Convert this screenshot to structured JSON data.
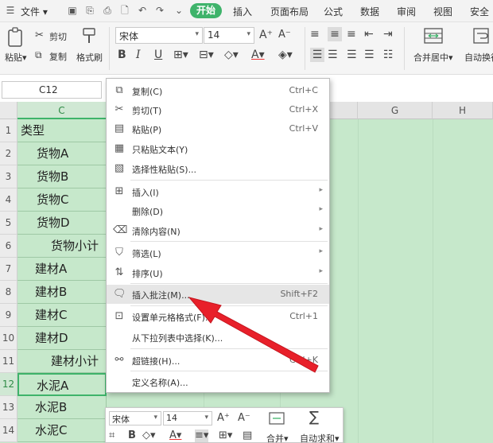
{
  "menubar": {
    "file": "文件",
    "tabs": [
      "开始",
      "插入",
      "页面布局",
      "公式",
      "数据",
      "审阅",
      "视图",
      "安全"
    ]
  },
  "ribbon": {
    "paste": "粘贴",
    "cut": "剪切",
    "copy": "复制",
    "format_painter": "格式刷",
    "font_name": "宋体",
    "font_size": "14",
    "merge_center": "合并居中",
    "wrap_text": "自动换行"
  },
  "name_box": "C12",
  "columns": [
    "C",
    "G",
    "H"
  ],
  "rows": [
    {
      "num": "1",
      "c": "类型"
    },
    {
      "num": "2",
      "c": "货物A"
    },
    {
      "num": "3",
      "c": "货物B"
    },
    {
      "num": "4",
      "c": "货物C"
    },
    {
      "num": "5",
      "c": "货物D"
    },
    {
      "num": "6",
      "c": "货物小计"
    },
    {
      "num": "7",
      "c": "建材A"
    },
    {
      "num": "8",
      "c": "建材B"
    },
    {
      "num": "9",
      "c": "建材C"
    },
    {
      "num": "10",
      "c": "建材D"
    },
    {
      "num": "11",
      "c": "建材小计"
    },
    {
      "num": "12",
      "c": "水泥A"
    },
    {
      "num": "13",
      "c": "水泥B"
    },
    {
      "num": "14",
      "c": "水泥C"
    }
  ],
  "context_menu": {
    "copy": {
      "label": "复制(C)",
      "shortcut": "Ctrl+C",
      "icon": "copy-icon"
    },
    "cut": {
      "label": "剪切(T)",
      "shortcut": "Ctrl+X",
      "icon": "scissors-icon"
    },
    "paste": {
      "label": "粘贴(P)",
      "shortcut": "Ctrl+V",
      "icon": "paste-icon"
    },
    "paste_text": {
      "label": "只粘贴文本(Y)",
      "icon": "paste-text-icon"
    },
    "paste_special": {
      "label": "选择性粘贴(S)...",
      "icon": "paste-special-icon"
    },
    "insert": {
      "label": "插入(I)",
      "icon": "insert-icon"
    },
    "delete": {
      "label": "删除(D)"
    },
    "clear": {
      "label": "清除内容(N)",
      "icon": "eraser-icon"
    },
    "filter": {
      "label": "筛选(L)",
      "icon": "filter-icon"
    },
    "sort": {
      "label": "排序(U)",
      "icon": "sort-icon"
    },
    "insert_comment": {
      "label": "插入批注(M)...",
      "shortcut": "Shift+F2",
      "icon": "comment-icon"
    },
    "format_cells": {
      "label": "设置单元格格式(F)...",
      "shortcut": "Ctrl+1",
      "icon": "format-cells-icon"
    },
    "pick_list": {
      "label": "从下拉列表中选择(K)..."
    },
    "hyperlink": {
      "label": "超链接(H)...",
      "shortcut": "Ctrl+K",
      "icon": "link-icon"
    },
    "define_name": {
      "label": "定义名称(A)..."
    }
  },
  "mini_toolbar": {
    "font_name": "宋体",
    "font_size": "14",
    "merge": "合并",
    "autosum": "自动求和"
  },
  "colors": {
    "accent": "#3eb36a",
    "sheet_fill": "#c6e8cb",
    "arrow": "#e8202a"
  }
}
